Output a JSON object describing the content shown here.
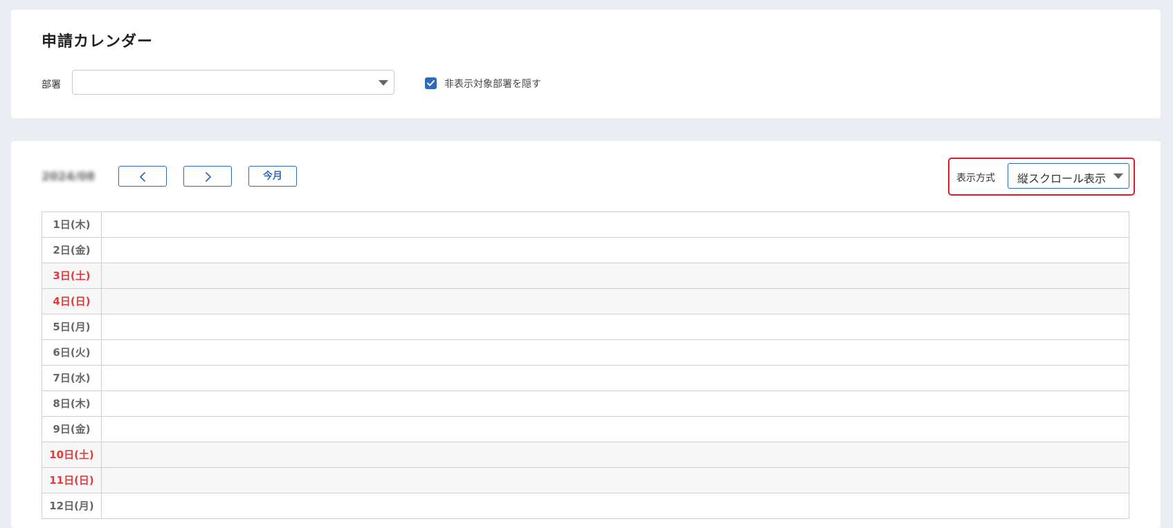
{
  "header": {
    "title": "申請カレンダー",
    "department_label": "部署",
    "department_value": "",
    "hide_checkbox_label": "非表示対象部署を隠す",
    "hide_checkbox_checked": true
  },
  "calendar_toolbar": {
    "month_label": "2024/08",
    "today_button": "今月",
    "display_mode_label": "表示方式",
    "display_mode_value": "縦スクロール表示"
  },
  "days": [
    {
      "label": "1日(木)",
      "weekend": false
    },
    {
      "label": "2日(金)",
      "weekend": false
    },
    {
      "label": "3日(土)",
      "weekend": true
    },
    {
      "label": "4日(日)",
      "weekend": true
    },
    {
      "label": "5日(月)",
      "weekend": false
    },
    {
      "label": "6日(火)",
      "weekend": false
    },
    {
      "label": "7日(水)",
      "weekend": false
    },
    {
      "label": "8日(木)",
      "weekend": false
    },
    {
      "label": "9日(金)",
      "weekend": false
    },
    {
      "label": "10日(土)",
      "weekend": true
    },
    {
      "label": "11日(日)",
      "weekend": true
    },
    {
      "label": "12日(月)",
      "weekend": false
    }
  ],
  "colors": {
    "accent": "#2d6bb5",
    "weekend_text": "#e33b3b",
    "highlight_border": "#e21b23"
  }
}
